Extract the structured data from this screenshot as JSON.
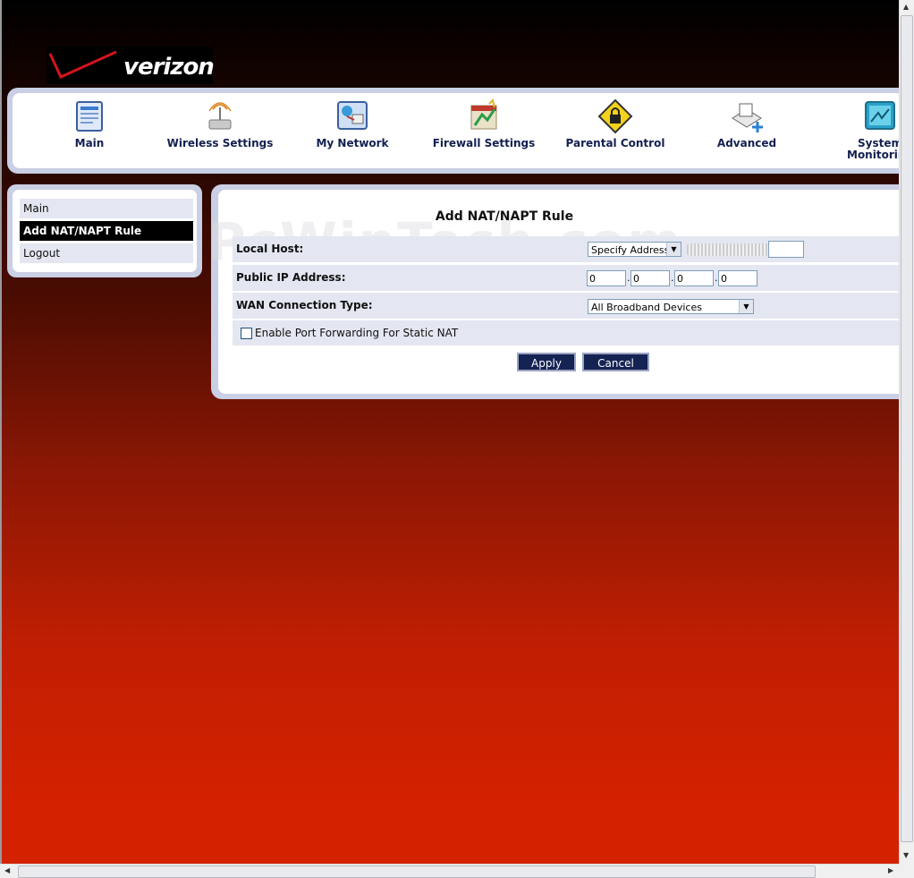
{
  "brand": {
    "logo_text": "verizon"
  },
  "watermark": "PcWinTech.com",
  "nav": {
    "items": [
      {
        "label": "Main",
        "icon": "main-icon"
      },
      {
        "label": "Wireless Settings",
        "icon": "wireless-icon"
      },
      {
        "label": "My Network",
        "icon": "network-icon"
      },
      {
        "label": "Firewall Settings",
        "icon": "firewall-icon"
      },
      {
        "label": "Parental Control",
        "icon": "lock-icon"
      },
      {
        "label": "Advanced",
        "icon": "advanced-icon"
      },
      {
        "label": "System Monitoring",
        "icon": "monitor-icon"
      }
    ]
  },
  "sidebar": {
    "items": [
      {
        "label": "Main",
        "active": false
      },
      {
        "label": "Add NAT/NAPT Rule",
        "active": true
      },
      {
        "label": "Logout",
        "active": false
      }
    ]
  },
  "form": {
    "title": "Add NAT/NAPT Rule",
    "local_host": {
      "label": "Local Host:",
      "select_value": "Specify Address",
      "input_value": ""
    },
    "public_ip": {
      "label": "Public IP Address:",
      "octets": [
        "0",
        "0",
        "0",
        "0"
      ]
    },
    "wan_type": {
      "label": "WAN Connection Type:",
      "select_value": "All Broadband Devices"
    },
    "port_forwarding": {
      "label": "Enable Port Forwarding For Static NAT",
      "checked": false
    },
    "apply_label": "Apply",
    "cancel_label": "Cancel"
  },
  "colors": {
    "nav_text": "#132050",
    "button_bg": "#152353",
    "panel_border": "#c9cfe4",
    "row_bg": "#e4e7f1",
    "gradient_bottom": "#d42100"
  }
}
